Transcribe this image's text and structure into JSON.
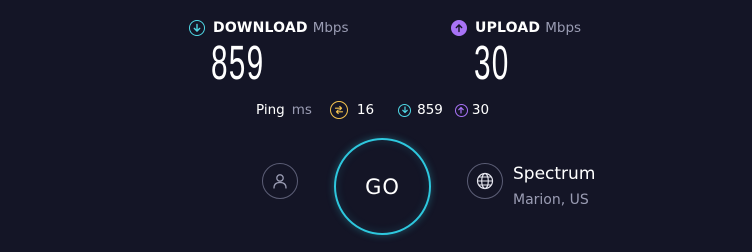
{
  "download": {
    "label": "DOWNLOAD",
    "unit": "Mbps",
    "value": "859",
    "icon": "arrow-down-circle-icon",
    "color": "#4fd8e6"
  },
  "upload": {
    "label": "UPLOAD",
    "unit": "Mbps",
    "value": "30",
    "icon": "arrow-up-circle-icon",
    "color": "#a873f6"
  },
  "ping": {
    "label": "Ping",
    "unit": "ms",
    "idle_value": "16",
    "download_value": "859",
    "upload_value": "30",
    "icon": "ping-icon",
    "color": "#f2c14e"
  },
  "go_button": {
    "label": "GO",
    "color": "#2ec8de"
  },
  "account": {
    "icon": "user-icon"
  },
  "provider": {
    "icon": "globe-icon",
    "name": "Spectrum",
    "location": "Marion, US"
  },
  "colors": {
    "background": "#141526",
    "muted_text": "#9a9cb3"
  }
}
